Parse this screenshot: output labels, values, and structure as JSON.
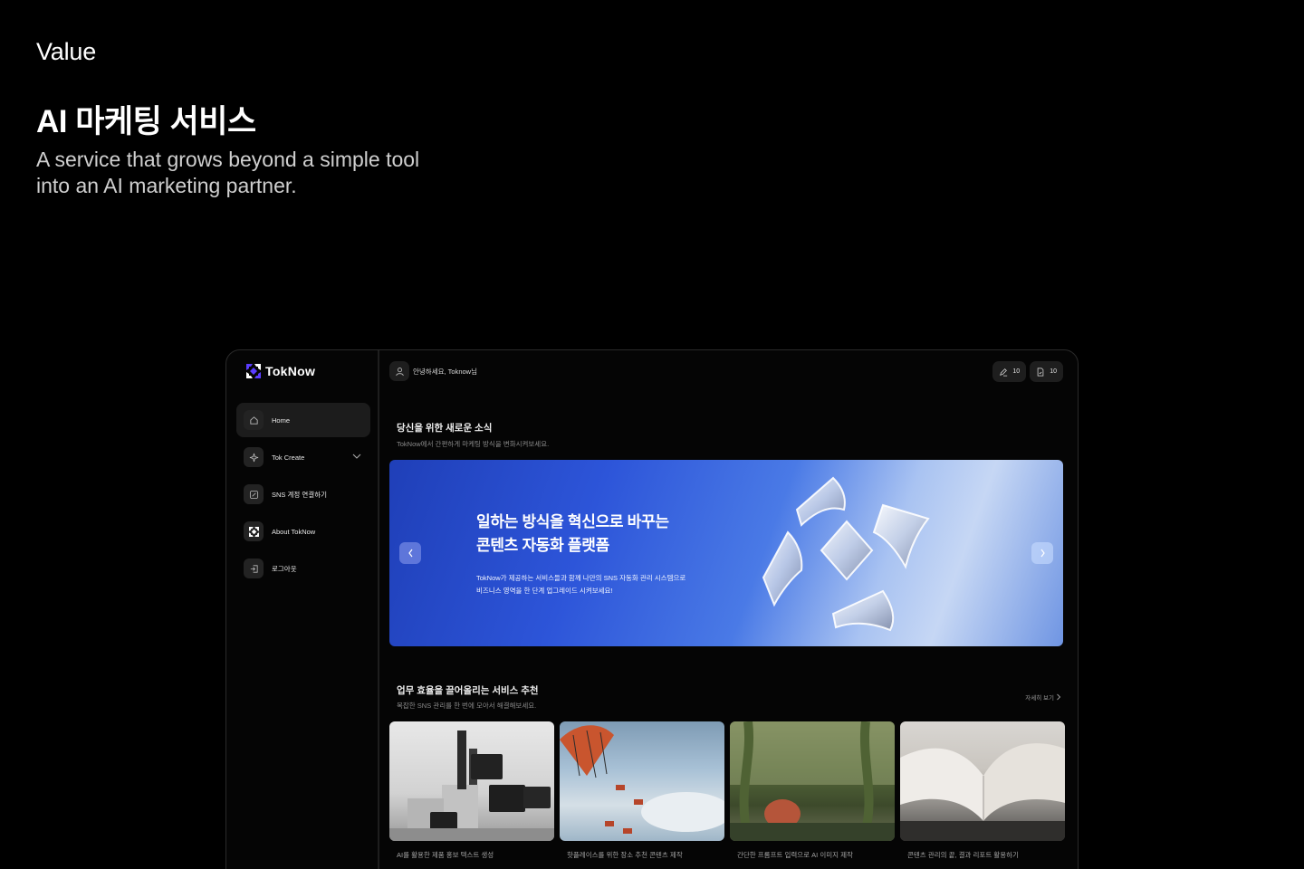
{
  "page": {
    "section_label": "Value",
    "title": "AI 마케팅 서비스",
    "subtitle_line1": "A service that grows beyond a simple tool",
    "subtitle_line2": "into an AI marketing partner."
  },
  "app": {
    "brand": "TokNow",
    "sidebar": {
      "items": [
        {
          "label": "Home",
          "icon": "home-icon",
          "active": true
        },
        {
          "label": "Tok Create",
          "icon": "sparkle-icon",
          "has_submenu": true
        },
        {
          "label": "SNS 계정 연결하기",
          "icon": "edit-icon"
        },
        {
          "label": "About TokNow",
          "icon": "logo-icon"
        },
        {
          "label": "로그아웃",
          "icon": "logout-icon"
        }
      ]
    },
    "header": {
      "greeting": "안녕하세요, Toknow님",
      "counter_edit": "10",
      "counter_doc": "10"
    },
    "news": {
      "title": "당신을 위한 새로운 소식",
      "desc": "TokNow에서 간편하게 마케팅 방식을 변화시켜보세요."
    },
    "banner": {
      "headline_line1": "일하는 방식을 혁신으로 바꾸는",
      "headline_line2": "콘텐츠 자동화 플랫폼",
      "body_line1": "TokNow가 제공하는 서비스들과 함께 나만의 SNS 자동화 관리 시스템으로",
      "body_line2": "비즈니스 영역을 한 단계 업그레이드 시켜보세요!"
    },
    "services": {
      "title": "업무 효율을 끌어올리는 서비스 추천",
      "desc": "복잡한 SNS 관리를 한 번에 모아서 해결해보세요.",
      "more": "자세히 보기",
      "cards": [
        {
          "label": "AI를 활용한 제품 홍보 텍스트 생성"
        },
        {
          "label": "핫플레이스를 위한 장소 추천 콘텐츠 제작"
        },
        {
          "label": "간단한 프롬프트 입력으로 AI 이미지 제작"
        },
        {
          "label": "콘텐츠 관리의 끝, 결과 리포트 활용하기"
        }
      ]
    },
    "colors": {
      "accent": "#5b3cff",
      "glow": "#4a35f0",
      "banner_blue": "#2d55d9"
    }
  }
}
